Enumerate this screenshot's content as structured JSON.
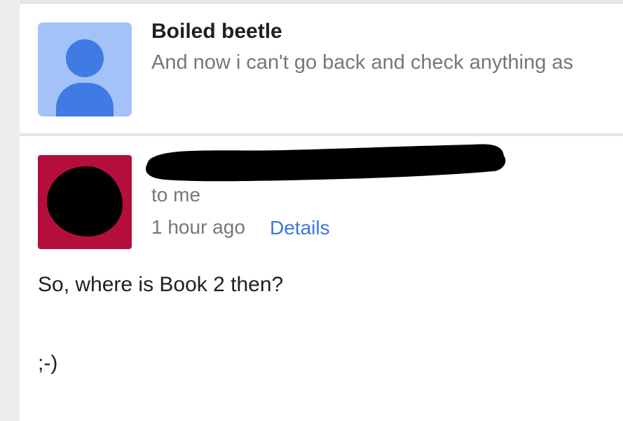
{
  "collapsed_message": {
    "sender": "Boiled beetle",
    "snippet": "And now i can't go back and check anything as"
  },
  "expanded_message": {
    "recipient": "to me",
    "time": "1 hour ago",
    "details_link": "Details",
    "body": [
      "So, where is Book 2 then?",
      ";-)"
    ]
  },
  "colors": {
    "default_avatar_bg": "#a3c2f8",
    "default_avatar_fg": "#3f7be3",
    "user_avatar_bg": "#b50e3c",
    "link": "#3d77db"
  },
  "icons": {
    "default_avatar": "person-icon"
  }
}
